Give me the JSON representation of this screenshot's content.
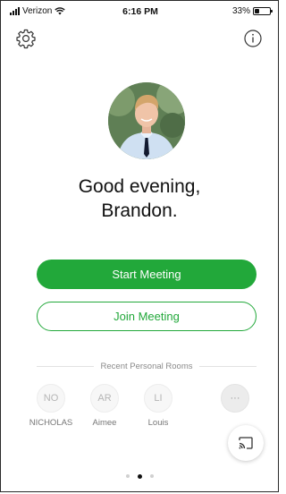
{
  "status_bar": {
    "carrier": "Verizon",
    "time": "6:16 PM",
    "battery_percent": "33%",
    "battery_level": 0.33
  },
  "header": {
    "left_icon": "gear-icon",
    "right_icon": "info-icon"
  },
  "greeting": {
    "line1": "Good evening,",
    "line2": "Brandon."
  },
  "actions": {
    "start_meeting": "Start Meeting",
    "join_meeting": "Join Meeting"
  },
  "recent_rooms": {
    "title": "Recent Personal Rooms",
    "rooms": [
      {
        "initials": "NO",
        "name": "NICHOLAS"
      },
      {
        "initials": "AR",
        "name": "Aimee"
      },
      {
        "initials": "LI",
        "name": "Louis"
      },
      {
        "initials": "···",
        "name": ""
      }
    ]
  },
  "fab": {
    "icon": "cast-icon"
  },
  "pager": {
    "count": 3,
    "active": 1
  },
  "colors": {
    "accent": "#22a83a",
    "text": "#111111",
    "muted": "#8a8a8a"
  }
}
